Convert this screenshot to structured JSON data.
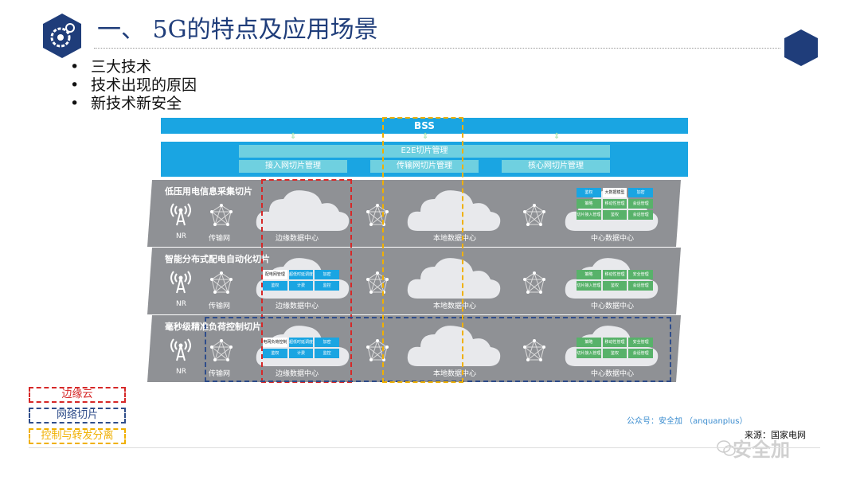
{
  "title": "一、 5G的特点及应用场景",
  "bullets": [
    "三大技术",
    "技术出现的原因",
    "新技术新安全"
  ],
  "diagram": {
    "bss": "BSS",
    "e2e": "E2E切片管理",
    "sub_mgmt": [
      "接入网切片管理",
      "传输网切片管理",
      "核心网切片管理"
    ],
    "slices": [
      {
        "name": "低压用电信息采集切片",
        "nr": "NR",
        "transport": "传输网",
        "edge_dc": "边缘数据中心",
        "local_dc": "本地数据中心",
        "center_dc": "中心数据中心",
        "edge_cells": [],
        "center_cells": [
          {
            "t": "鉴权",
            "c": "blue"
          },
          {
            "t": "大数据\n模型",
            "c": "white"
          },
          {
            "t": "加密",
            "c": "blue"
          },
          {
            "t": "策略",
            "c": "green"
          },
          {
            "t": "移动性\n管理",
            "c": "green"
          },
          {
            "t": "会话管理",
            "c": "green"
          },
          {
            "t": "切片接入\n管理",
            "c": "green"
          },
          {
            "t": "鉴权",
            "c": "green"
          },
          {
            "t": "会话管理",
            "c": "green"
          }
        ]
      },
      {
        "name": "智能分布式配电自动化切片",
        "nr": "NR",
        "transport": "传输网",
        "edge_dc": "边缘数据中心",
        "local_dc": "本地数据中心",
        "center_dc": "中心数据中心",
        "edge_cells": [
          {
            "t": "配电网\n管理",
            "c": "white"
          },
          {
            "t": "超低时延\n调度",
            "c": "blue"
          },
          {
            "t": "加密",
            "c": "blue"
          },
          {
            "t": "鉴权",
            "c": "blue"
          },
          {
            "t": "计费",
            "c": "blue"
          },
          {
            "t": "监控",
            "c": "blue"
          }
        ],
        "center_cells": [
          {
            "t": "策略",
            "c": "green"
          },
          {
            "t": "移动性\n管理",
            "c": "green"
          },
          {
            "t": "安全管理",
            "c": "green"
          },
          {
            "t": "切片接入\n管理",
            "c": "green"
          },
          {
            "t": "鉴权",
            "c": "green"
          },
          {
            "t": "会话管理",
            "c": "green"
          }
        ]
      },
      {
        "name": "毫秒级精准负荷控制切片",
        "nr": "NR",
        "transport": "传输网",
        "edge_dc": "边缘数据中心",
        "local_dc": "本地数据中心",
        "center_dc": "中心数据中心",
        "edge_cells": [
          {
            "t": "电网负荷\n控制",
            "c": "white"
          },
          {
            "t": "超低时延\n调度",
            "c": "blue"
          },
          {
            "t": "加密",
            "c": "blue"
          },
          {
            "t": "鉴权",
            "c": "blue"
          },
          {
            "t": "计费",
            "c": "blue"
          },
          {
            "t": "监控",
            "c": "blue"
          }
        ],
        "center_cells": [
          {
            "t": "策略",
            "c": "green"
          },
          {
            "t": "移动性\n管理",
            "c": "green"
          },
          {
            "t": "安全管理",
            "c": "green"
          },
          {
            "t": "切片接入\n管理",
            "c": "green"
          },
          {
            "t": "鉴权",
            "c": "green"
          },
          {
            "t": "会话管理",
            "c": "green"
          }
        ]
      }
    ]
  },
  "legend": [
    {
      "label": "边缘云",
      "color": "#d62828"
    },
    {
      "label": "网络切片",
      "color": "#2f4d8a"
    },
    {
      "label": "控制与转发分离",
      "color": "#f0b000"
    }
  ],
  "source_account": "公众号：安全加 （anquanplus）",
  "source_origin": "来源：国家电网",
  "watermark": "安全加",
  "colors": {
    "title": "#1f3d7a",
    "accent_blue": "#1aa5e2",
    "slice_gray": "#8f9195"
  }
}
